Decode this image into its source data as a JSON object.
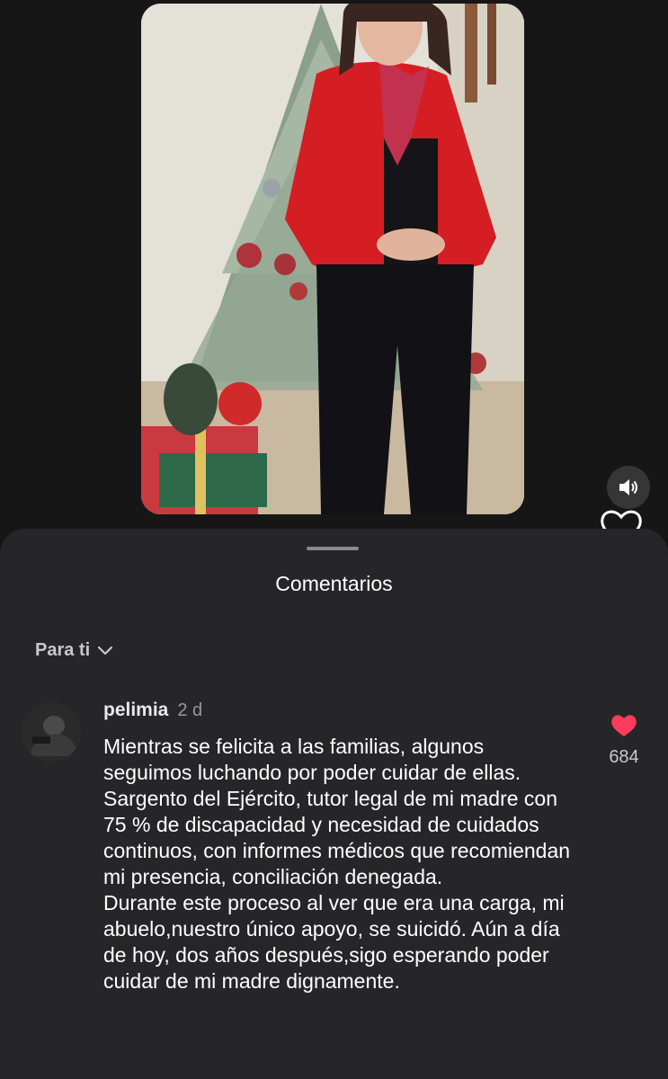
{
  "colors": {
    "background": "#161616",
    "sheet": "#262628",
    "like_red": "#ff3b5c",
    "text_primary": "#ffffff",
    "text_secondary": "#9a9a9c"
  },
  "video": {
    "icons": [
      "volume-icon",
      "heart-outline-icon"
    ]
  },
  "comments_sheet": {
    "title": "Comentarios",
    "filter_label": "Para ti",
    "filter_icon": "chevron-down-icon"
  },
  "comment": {
    "username": "pelimia",
    "time": "2 d",
    "text": "Mientras se felicita a las familias, algunos seguimos luchando por poder cuidar de ellas.\nSargento del Ejército, tutor legal de mi madre con 75 % de discapacidad y necesidad de cuidados continuos, con informes médicos que recomiendan mi presencia, conciliación denegada.\nDurante este proceso al ver que era una carga, mi abuelo,nuestro único apoyo, se suicidó. Aún a día de hoy, dos años después,sigo esperando poder cuidar de mi madre dignamente.",
    "likes": "684",
    "like_icon": "heart-filled-icon"
  }
}
